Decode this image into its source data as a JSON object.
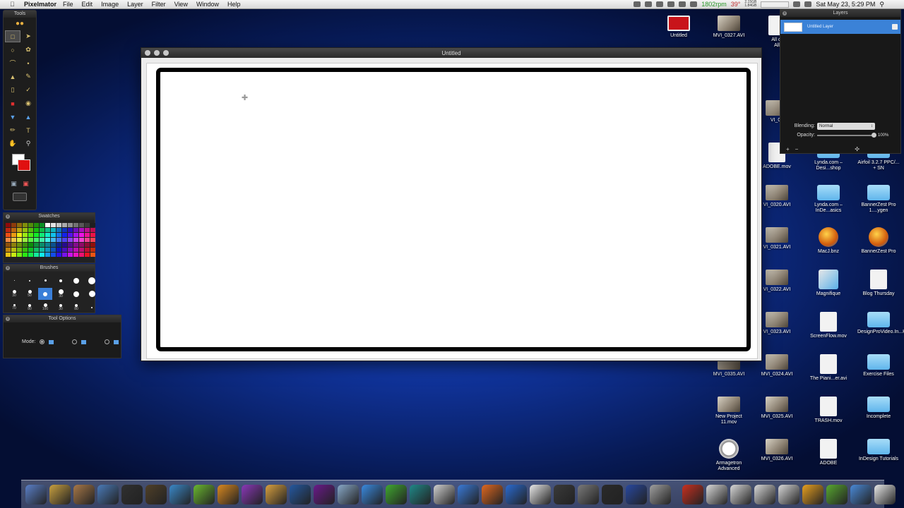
{
  "menubar": {
    "app_name": "Pixelmator",
    "items": [
      "File",
      "Edit",
      "Image",
      "Layer",
      "Filter",
      "View",
      "Window",
      "Help"
    ],
    "status": {
      "rpm": "1802rpm",
      "temp": "39°",
      "mem_top": "2.15GB",
      "mem_bottom": "1.84GB",
      "clock": "Sat May 23, 5:29 PM"
    }
  },
  "tools_palette": {
    "title": "Tools"
  },
  "swatches_palette": {
    "title": "Swatches"
  },
  "brushes_palette": {
    "title": "Brushes",
    "sizes": [
      "",
      "",
      "",
      "",
      "",
      "",
      "30",
      "50",
      "",
      "30",
      "",
      "",
      " 70",
      "80",
      "100",
      "30",
      "80",
      ""
    ]
  },
  "tool_options": {
    "title": "Tool Options",
    "mode_label": "Mode:"
  },
  "document": {
    "title": "Untitled"
  },
  "layers_panel": {
    "title": "Layers",
    "layer_name": "Untitled Layer",
    "blending_label": "Blending:",
    "blending_value": "Normal",
    "opacity_label": "Opacity:",
    "opacity_value": "100%",
    "add_label": "+",
    "remove_label": "−",
    "settings_label": "✣"
  },
  "desktop_icons": [
    {
      "label": "Untitled",
      "kind": "red"
    },
    {
      "label": "MVI_0327.AVI",
      "kind": "video"
    },
    {
      "label": "All of\nAll",
      "kind": "doc"
    },
    {
      "label": "VI_03",
      "kind": "video"
    },
    {
      "label": "ADOBE.mov",
      "kind": "doc"
    },
    {
      "label": "Lynda.com – Desi...shop",
      "kind": "folder"
    },
    {
      "label": "Airfoil 3.2.7 PPC/... + SN",
      "kind": "folder"
    },
    {
      "label": "VI_0320.AVI",
      "kind": "video"
    },
    {
      "label": "Lynda.com – InDe...asics",
      "kind": "folder"
    },
    {
      "label": "BannerZest Pro 1....ygen",
      "kind": "folder"
    },
    {
      "label": "VI_0321.AVI",
      "kind": "video"
    },
    {
      "label": "MacJ.bnz",
      "kind": "orb"
    },
    {
      "label": "BannerZest Pro",
      "kind": "orb"
    },
    {
      "label": "VI_0322.AVI",
      "kind": "video"
    },
    {
      "label": "Magnifique",
      "kind": "star"
    },
    {
      "label": "Blog Thursday",
      "kind": "doc"
    },
    {
      "label": "VI_0323.AVI",
      "kind": "video"
    },
    {
      "label": "ScreenFlow.mov",
      "kind": "doc"
    },
    {
      "label": "DesignProVideo.In...KiSO",
      "kind": "folder"
    },
    {
      "label": "MVI_0335.AVI",
      "kind": "video"
    },
    {
      "label": "MVI_0324.AVI",
      "kind": "video"
    },
    {
      "label": "The Piani...er.avi",
      "kind": "doc"
    },
    {
      "label": "Exercise Files",
      "kind": "folder"
    },
    {
      "label": "New Project 11.mov",
      "kind": "video"
    },
    {
      "label": "MVI_0325.AVI",
      "kind": "video"
    },
    {
      "label": "TRASH.mov",
      "kind": "doc"
    },
    {
      "label": "Incomplete",
      "kind": "folder"
    },
    {
      "label": "Armagetron Advanced",
      "kind": "ban"
    },
    {
      "label": "MVI_0326.AVI",
      "kind": "video"
    },
    {
      "label": "ADOBE",
      "kind": "doc"
    },
    {
      "label": "InDesign Tutorials",
      "kind": "folder"
    }
  ],
  "dock": {
    "colors": [
      "#5a7fc8",
      "#c8a040",
      "#a87848",
      "#4a7ab8",
      "#303030",
      "#504028",
      "#3a88c8",
      "#6ab830",
      "#d88820",
      "#8a38b8",
      "#d8a040",
      "#2458a0",
      "#6a1a8a",
      "#88a8c8",
      "#3a8ae0",
      "#40a830",
      "#208888",
      "#d0d0d0",
      "#3a7ad8",
      "#e06820",
      "#2a6ad0",
      "#e8e8e8",
      "#3a3a3a",
      "#7a7a7a",
      "#2a2a2a",
      "#2848a0",
      "#a0a0a0",
      "#c83020",
      "#d8d8d8",
      "#d8d8d8",
      "#d8d8d8",
      "#d8d8d8",
      "#e8a020",
      "#58a830",
      "#4a8ad8",
      "#e8e8e8"
    ]
  }
}
